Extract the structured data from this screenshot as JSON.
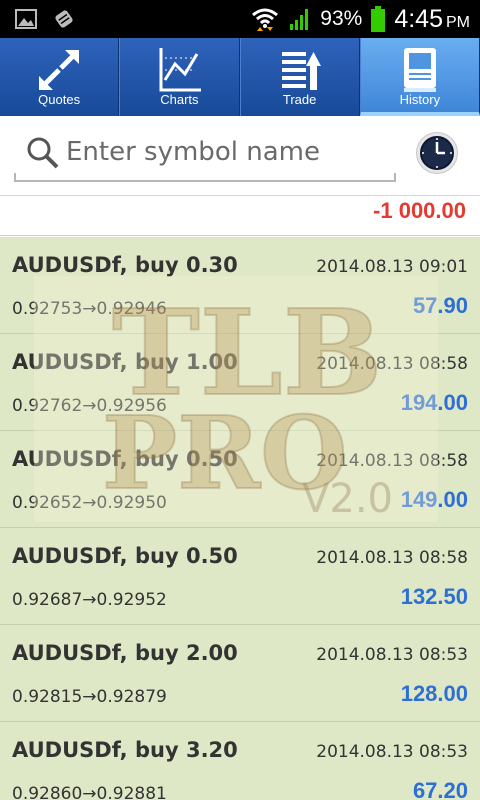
{
  "status_bar": {
    "battery_percent": "93%",
    "time": "4:45",
    "ampm": "PM",
    "icons": [
      "image-icon",
      "android-debug-icon",
      "wifi-icon",
      "signal-icon",
      "battery-icon"
    ]
  },
  "tabs": [
    {
      "label": "Quotes",
      "icon": "quotes-arrows-icon",
      "active": false
    },
    {
      "label": "Charts",
      "icon": "chart-icon",
      "active": false
    },
    {
      "label": "Trade",
      "icon": "trade-icon",
      "active": false
    },
    {
      "label": "History",
      "icon": "history-icon",
      "active": true
    }
  ],
  "search": {
    "placeholder": "Enter symbol name"
  },
  "total": "-1 000.00",
  "deals": [
    {
      "title": "AUDUSDf, buy 0.30",
      "time": "2014.08.13 09:01",
      "prices": "0.92753→0.92946",
      "profit": "57.90"
    },
    {
      "title": "AUDUSDf, buy 1.00",
      "time": "2014.08.13 08:58",
      "prices": "0.92762→0.92956",
      "profit": "194.00"
    },
    {
      "title": "AUDUSDf, buy 0.50",
      "time": "2014.08.13 08:58",
      "prices": "0.92652→0.92950",
      "profit": "149.00"
    },
    {
      "title": "AUDUSDf, buy 0.50",
      "time": "2014.08.13 08:58",
      "prices": "0.92687→0.92952",
      "profit": "132.50"
    },
    {
      "title": "AUDUSDf, buy 2.00",
      "time": "2014.08.13 08:53",
      "prices": "0.92815→0.92879",
      "profit": "128.00"
    },
    {
      "title": "AUDUSDf, buy 3.20",
      "time": "2014.08.13 08:53",
      "prices": "0.92860→0.92881",
      "profit": "67.20"
    }
  ],
  "watermark": {
    "text_line1": "TLB",
    "text_line2": "PRO",
    "version": "V2.0"
  },
  "colors": {
    "tab_bar": "#1f56a8",
    "tab_active": "#4f95e0",
    "list_bg": "#dfe8c6",
    "profit_blue": "#2d6fd4",
    "loss_red": "#e53a2f"
  }
}
